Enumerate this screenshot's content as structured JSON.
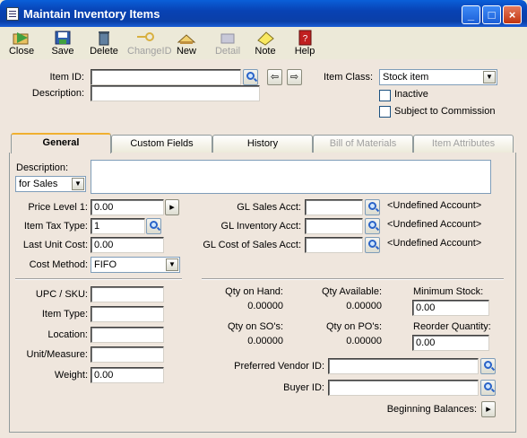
{
  "window": {
    "title": "Maintain Inventory Items"
  },
  "toolbar": {
    "close": "Close",
    "save": "Save",
    "delete": "Delete",
    "changeid": "ChangeID",
    "new": "New",
    "detail": "Detail",
    "note": "Note",
    "help": "Help"
  },
  "header": {
    "item_id_label": "Item ID:",
    "item_id_value": "",
    "description_label": "Description:",
    "description_value": "",
    "item_class_label": "Item Class:",
    "item_class_value": "Stock item",
    "inactive_label": "Inactive",
    "commission_label": "Subject to Commission"
  },
  "tabs": [
    {
      "label": "General",
      "active": true,
      "enabled": true
    },
    {
      "label": "Custom Fields",
      "active": false,
      "enabled": true
    },
    {
      "label": "History",
      "active": false,
      "enabled": true
    },
    {
      "label": "Bill of Materials",
      "active": false,
      "enabled": false
    },
    {
      "label": "Item Attributes",
      "active": false,
      "enabled": false
    }
  ],
  "general": {
    "description_label": "Description:",
    "desc_type": "for Sales",
    "description_value": "",
    "price_level_label": "Price Level 1:",
    "price_level_value": "0.00",
    "tax_type_label": "Item Tax Type:",
    "tax_type_value": "1",
    "last_cost_label": "Last Unit Cost:",
    "last_cost_value": "0.00",
    "cost_method_label": "Cost Method:",
    "cost_method_value": "FIFO",
    "gl_sales_label": "GL Sales Acct:",
    "gl_sales_value": "",
    "gl_sales_desc": "<Undefined Account>",
    "gl_inv_label": "GL Inventory Acct:",
    "gl_inv_value": "",
    "gl_inv_desc": "<Undefined Account>",
    "gl_cos_label": "GL Cost of Sales Acct:",
    "gl_cos_value": "",
    "gl_cos_desc": "<Undefined Account>",
    "upc_label": "UPC / SKU:",
    "upc_value": "",
    "item_type_label": "Item Type:",
    "item_type_value": "",
    "location_label": "Location:",
    "location_value": "",
    "unit_label": "Unit/Measure:",
    "unit_value": "",
    "weight_label": "Weight:",
    "weight_value": "0.00",
    "qty_on_hand_label": "Qty on Hand:",
    "qty_on_hand_value": "0.00000",
    "qty_available_label": "Qty Available:",
    "qty_available_value": "0.00000",
    "min_stock_label": "Minimum Stock:",
    "min_stock_value": "0.00",
    "qty_so_label": "Qty on SO's:",
    "qty_so_value": "0.00000",
    "qty_po_label": "Qty on PO's:",
    "qty_po_value": "0.00000",
    "reorder_label": "Reorder Quantity:",
    "reorder_value": "0.00",
    "vendor_label": "Preferred Vendor ID:",
    "vendor_value": "",
    "buyer_label": "Buyer ID:",
    "buyer_value": "",
    "beginning_label": "Beginning Balances:"
  }
}
